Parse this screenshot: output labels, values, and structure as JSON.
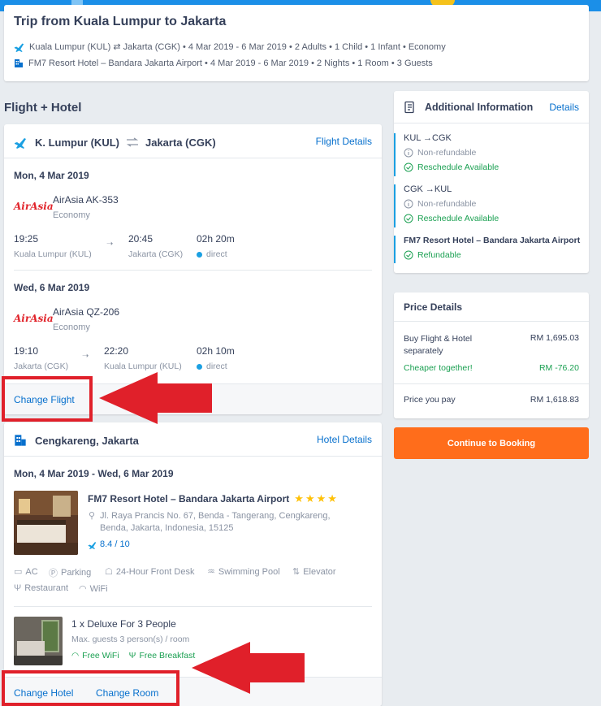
{
  "trip": {
    "title": "Trip from Kuala Lumpur to Jakarta",
    "flight_summary": "Kuala Lumpur (KUL) ⇄ Jakarta (CGK) • 4 Mar 2019 - 6 Mar 2019 • 2 Adults • 1 Child • 1 Infant • Economy",
    "hotel_summary": "FM7 Resort Hotel – Bandara Jakarta Airport • 4 Mar 2019 - 6 Mar 2019 • 2 Nights • 1 Room • 3 Guests"
  },
  "section_title": "Flight + Hotel",
  "flight": {
    "from": "K. Lumpur (KUL)",
    "to": "Jakarta (CGK)",
    "details_link": "Flight Details",
    "legs": [
      {
        "date": "Mon, 4 Mar 2019",
        "logo": "AirAsia",
        "airline": "AirAsia AK-353",
        "class": "Economy",
        "dep_time": "19:25",
        "dep_city": "Kuala Lumpur (KUL)",
        "arr_time": "20:45",
        "arr_city": "Jakarta (CGK)",
        "duration": "02h 20m",
        "stops": "direct"
      },
      {
        "date": "Wed, 6 Mar 2019",
        "logo": "AirAsia",
        "airline": "AirAsia QZ-206",
        "class": "Economy",
        "dep_time": "19:10",
        "dep_city": "Jakarta (CGK)",
        "arr_time": "22:20",
        "arr_city": "Kuala Lumpur (KUL)",
        "duration": "02h 10m",
        "stops": "direct"
      }
    ],
    "change_link": "Change Flight"
  },
  "hotel": {
    "location": "Cengkareng, Jakarta",
    "details_link": "Hotel Details",
    "dates": "Mon, 4 Mar 2019 - Wed, 6 Mar 2019",
    "name": "FM7 Resort Hotel – Bandara Jakarta Airport",
    "stars": 4,
    "address": "Jl. Raya Prancis No. 67, Benda - Tangerang, Cengkareng, Benda, Jakarta, Indonesia, 15125",
    "rating": "8.4 / 10",
    "amenities": [
      "AC",
      "Parking",
      "24-Hour Front Desk",
      "Swimming Pool",
      "Elevator",
      "Restaurant",
      "WiFi"
    ],
    "room": {
      "title": "1 x Deluxe For 3 People",
      "guests": "Max. guests 3 person(s) / room",
      "perk1": "Free WiFi",
      "perk2": "Free Breakfast"
    },
    "change_hotel": "Change Hotel",
    "change_room": "Change Room"
  },
  "additional": {
    "title": "Additional Information",
    "details_link": "Details",
    "items": [
      {
        "route": "KUL →CGK",
        "refund": "Non-refundable",
        "reschedule": "Reschedule Available"
      },
      {
        "route": "CGK →KUL",
        "refund": "Non-refundable",
        "reschedule": "Reschedule Available"
      }
    ],
    "hotel_name": "FM7 Resort Hotel – Bandara Jakarta Airport",
    "hotel_refund": "Refundable"
  },
  "price": {
    "title": "Price Details",
    "separate_label": "Buy Flight & Hotel separately",
    "separate_value": "RM 1,695.03",
    "cheaper_label": "Cheaper together!",
    "cheaper_value": "RM -76.20",
    "pay_label": "Price you pay",
    "pay_value": "RM 1,618.83"
  },
  "continue_button": "Continue to Booking",
  "colors": {
    "accent": "#0770cd",
    "cta": "#ff6d1b",
    "green": "#1ba052",
    "highlight": "#e0202a",
    "airasia": "#e1242b"
  }
}
